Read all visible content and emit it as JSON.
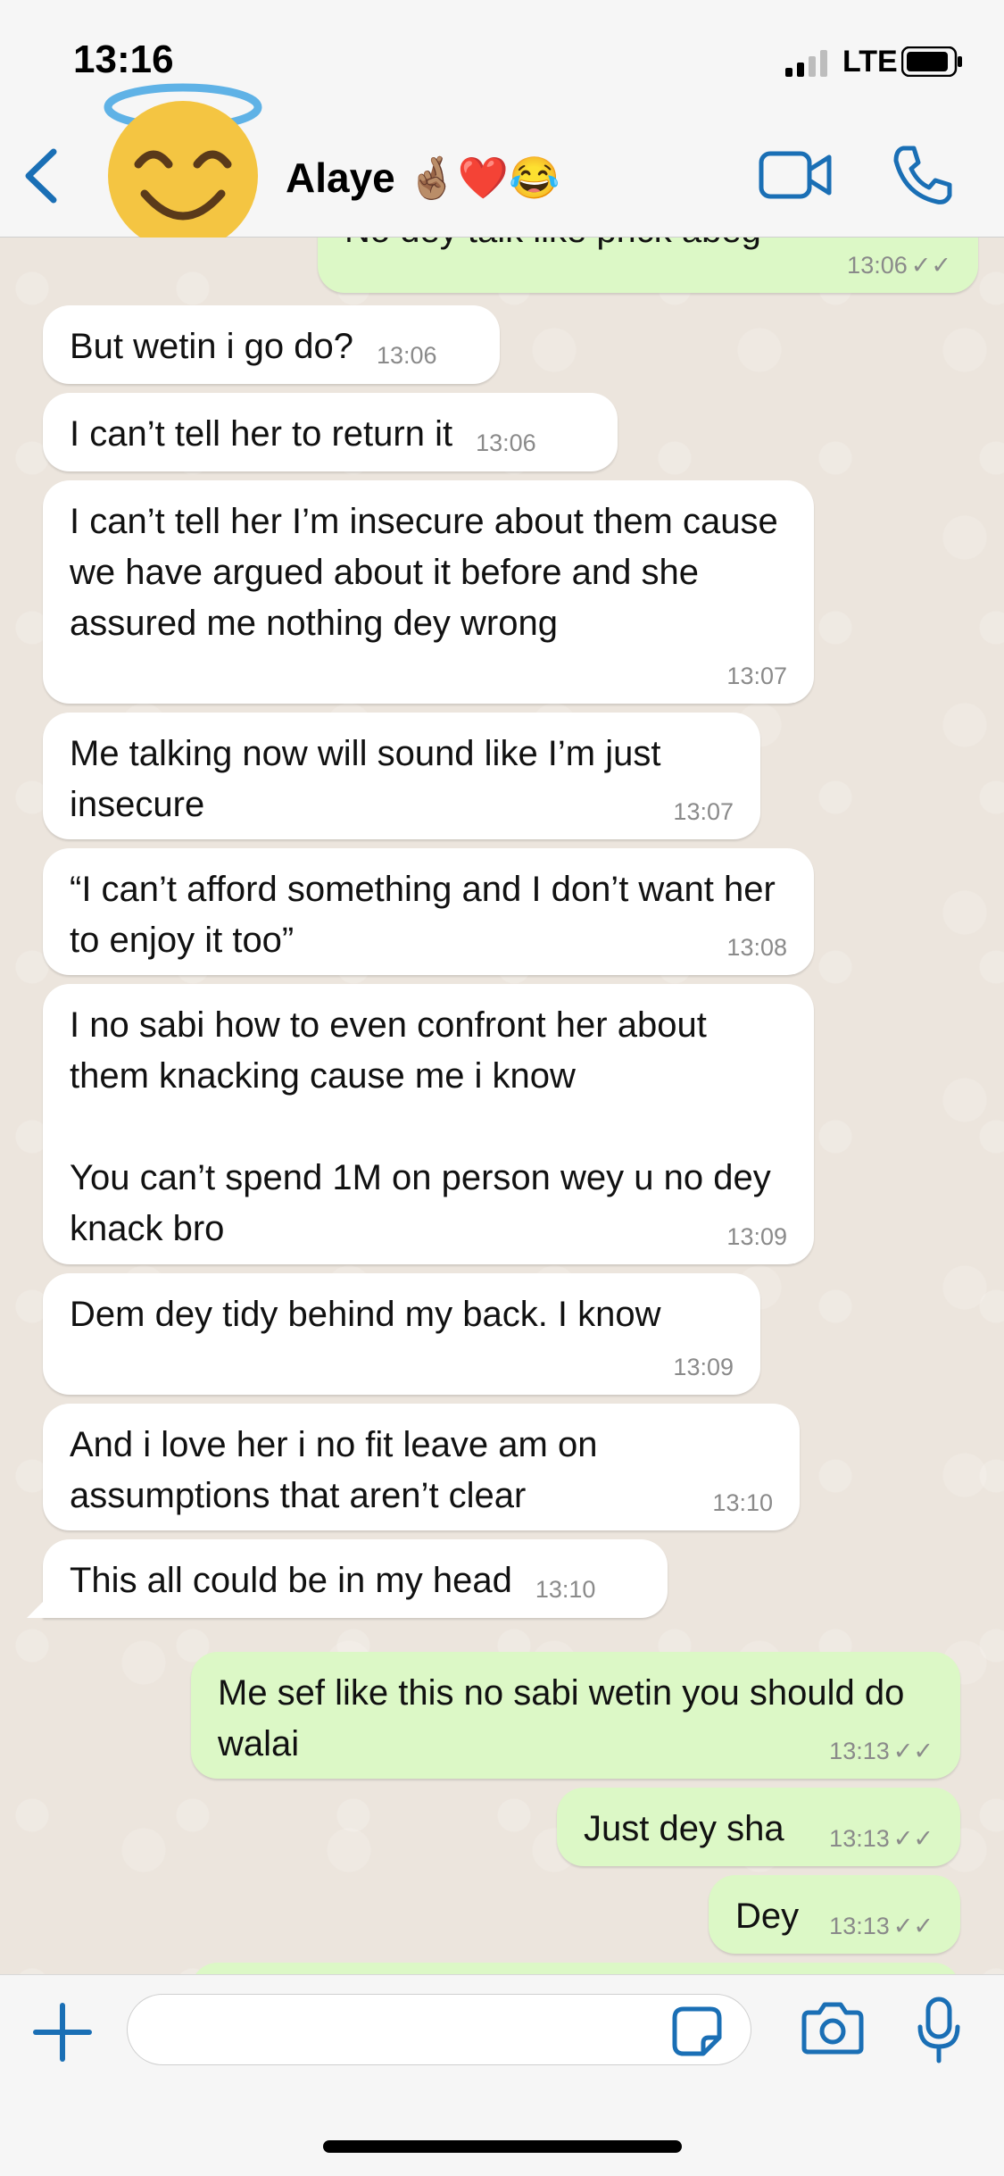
{
  "status_bar": {
    "time": "13:16",
    "network": "LTE"
  },
  "header": {
    "contact_name": "Alaye 🤞🏽❤️😂",
    "avatar_emoji": "😇"
  },
  "colors": {
    "accent": "#1a6fb5",
    "incoming_bubble": "#ffffff",
    "outgoing_bubble": "#dcf8c6",
    "chat_bg": "#ece5dd"
  },
  "messages": [
    {
      "text": "No dey talk like prick abeg",
      "time": "13:06",
      "ticks": "✓✓"
    },
    {
      "text": "But wetin i go do?",
      "time": "13:06"
    },
    {
      "text": "I can’t tell her to return it",
      "time": "13:06"
    },
    {
      "text": "I can’t tell her I’m insecure about them cause we have argued about it before and she assured me nothing dey wrong",
      "time": "13:07"
    },
    {
      "text": "Me talking now will sound like I’m just insecure",
      "time": "13:07"
    },
    {
      "text": "“I can’t afford something and I don’t want her to enjoy it too”",
      "time": "13:08"
    },
    {
      "text": "I no sabi how to even confront her about them knacking cause me i know\n\nYou can’t spend 1M on person wey u no dey knack bro",
      "time": "13:09"
    },
    {
      "text": "Dem dey tidy behind my back. I know",
      "time": "13:09"
    },
    {
      "text": "And i love her i no fit leave am on assumptions that aren’t clear",
      "time": "13:10"
    },
    {
      "text": "This all could be in my head",
      "time": "13:10"
    },
    {
      "text": "Me sef like this no sabi wetin you should do walai",
      "time": "13:13",
      "ticks": "✓✓"
    },
    {
      "text": "Just dey sha",
      "time": "13:13",
      "ticks": "✓✓"
    },
    {
      "text": "Dey",
      "time": "13:13",
      "ticks": "✓✓"
    }
  ],
  "icons": {
    "back": "chevron-left-icon",
    "video": "video-camera-icon",
    "call": "phone-icon",
    "plus": "plus-icon",
    "sticker": "sticker-icon",
    "camera": "camera-icon",
    "mic": "microphone-icon"
  }
}
